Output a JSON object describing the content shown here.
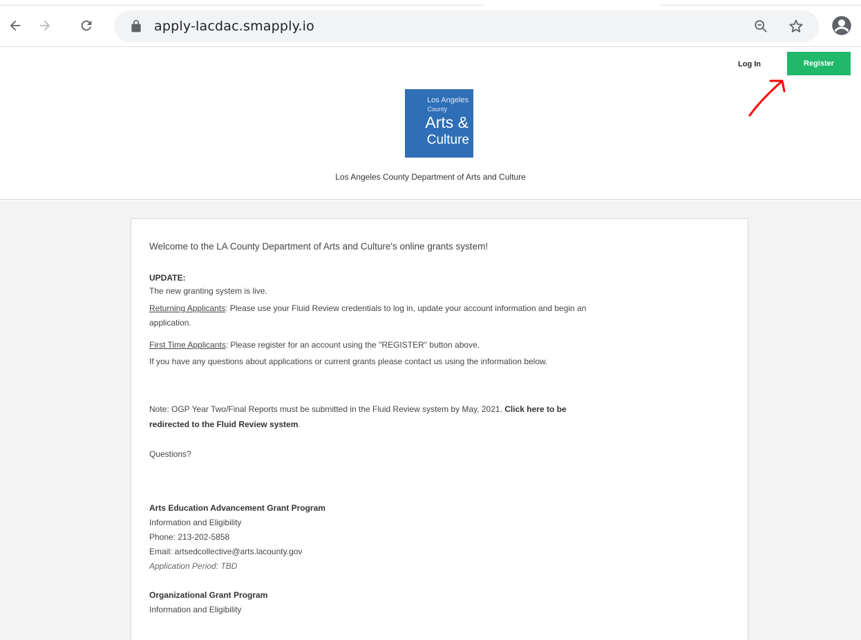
{
  "browser": {
    "url": "apply-lacdac.smapply.io"
  },
  "header": {
    "login_label": "Log In",
    "register_label": "Register",
    "logo": {
      "line1": "Los Angeles",
      "line2": "County",
      "line3": "Arts &",
      "line4": "Culture"
    },
    "department_name": "Los Angeles County Department of Arts and Culture"
  },
  "content": {
    "welcome": "Welcome to the LA County Department of Arts and Culture's online grants system!",
    "update_heading": "UPDATE:",
    "update_line1": "The new granting system is live.",
    "returning_label": "Returning Applicants",
    "returning_text": ": Please use your Fluid Review credentials to log in, update your account information and begin an",
    "returning_text2": "application.",
    "first_time_label": "First Time Applicants",
    "first_time_text": ": Please register for an account using the \"REGISTER\" button above.",
    "questions_line": "If you have any questions about applications or current grants please contact us using the information below.",
    "note_text": "Note: OGP Year Two/Final Reports must be submitted in the Fluid Review system by May, 2021. ",
    "note_link1": "Click here to be",
    "note_link2": "redirected to the Fluid Review system",
    "note_end": ".",
    "questions_heading": "Questions?",
    "programs": [
      {
        "title": "Arts Education Advancement Grant Program",
        "info": "Information and Eligibility",
        "phone": "Phone: 213-202-5858",
        "email": "Email: artsedcollective@arts.lacounty.gov",
        "period": "Application Period: TBD"
      },
      {
        "title": "Organizational Grant Program",
        "info": "Information and Eligibility"
      }
    ]
  },
  "colors": {
    "register_green": "#20b86a",
    "logo_blue": "#2f6fb7",
    "annotation_red": "#ff0000"
  }
}
